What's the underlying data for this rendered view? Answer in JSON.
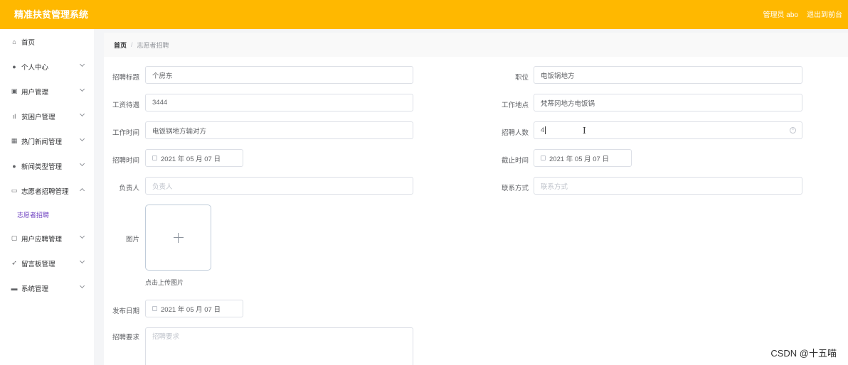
{
  "header": {
    "app_title": "精准扶贫管理系统",
    "user_label": "管理员 abo",
    "logout_label": "退出到前台"
  },
  "sidebar": {
    "items": [
      {
        "label": "首页",
        "icon": "home-icon",
        "glyph": "⌂"
      },
      {
        "label": "个人中心",
        "icon": "user-icon",
        "glyph": "●"
      },
      {
        "label": "用户管理",
        "icon": "edit-icon",
        "glyph": "▣"
      },
      {
        "label": "贫困户管理",
        "icon": "chart-icon",
        "glyph": "ıl"
      },
      {
        "label": "热门新闻管理",
        "icon": "grid-icon",
        "glyph": "▦"
      },
      {
        "label": "新闻类型管理",
        "icon": "user-icon",
        "glyph": "●"
      },
      {
        "label": "志愿者招聘管理",
        "icon": "data-icon",
        "glyph": "▭"
      },
      {
        "label": "用户应聘管理",
        "icon": "message-icon",
        "glyph": "▢"
      },
      {
        "label": "留言板管理",
        "icon": "send-icon",
        "glyph": "➶"
      },
      {
        "label": "系统管理",
        "icon": "briefcase-icon",
        "glyph": "▬"
      }
    ],
    "submenu": {
      "label": "志愿者招聘"
    }
  },
  "breadcrumb": {
    "home": "首页",
    "separator": "/",
    "current": "志愿者招聘"
  },
  "form": {
    "title": {
      "label": "招聘标题",
      "value": "个房东"
    },
    "position": {
      "label": "职位",
      "value": "电饭锅地方"
    },
    "salary": {
      "label": "工资待遇",
      "value": "3444"
    },
    "location": {
      "label": "工作地点",
      "value": "梵蒂冈地方电饭锅"
    },
    "work_time": {
      "label": "工作时间",
      "value": "电饭锅地方输对方"
    },
    "headcount": {
      "label": "招聘人数",
      "value": "4"
    },
    "recruit_date": {
      "label": "招聘时间",
      "value": "2021 年 05 月 07 日"
    },
    "deadline": {
      "label": "截止时间",
      "value": "2021 年 05 月 07 日"
    },
    "person_in_charge": {
      "label": "负责人",
      "placeholder": "负责人"
    },
    "contact": {
      "label": "联系方式",
      "placeholder": "联系方式"
    },
    "image": {
      "label": "图片",
      "upload_tip": "点击上传图片"
    },
    "publish_date": {
      "label": "发布日期",
      "value": "2021 年 05 月 07 日"
    },
    "requirements": {
      "label": "招聘要求",
      "placeholder": "招聘要求"
    }
  },
  "watermark": "CSDN @十五喵",
  "colors": {
    "header": "#ffb800",
    "active_submenu": "#6f42c1"
  }
}
